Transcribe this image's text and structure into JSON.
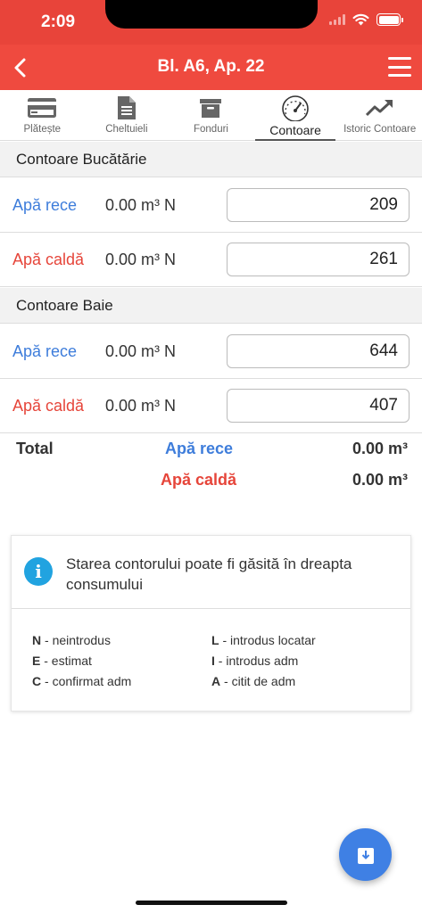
{
  "status_bar": {
    "time": "2:09"
  },
  "header": {
    "title": "Bl. A6, Ap. 22"
  },
  "tabs": [
    {
      "label": "Plătește",
      "icon": "credit-card-icon"
    },
    {
      "label": "Cheltuieli",
      "icon": "document-icon"
    },
    {
      "label": "Fonduri",
      "icon": "archive-box-icon"
    },
    {
      "label": "Contoare",
      "icon": "speedometer-icon",
      "active": true
    },
    {
      "label": "Istoric Contoare",
      "icon": "trending-up-icon"
    }
  ],
  "sections": [
    {
      "title": "Contoare Bucătărie",
      "meters": [
        {
          "name": "Apă rece",
          "consum": "0.00 m³ N",
          "value": "209"
        },
        {
          "name": "Apă caldă",
          "consum": "0.00 m³ N",
          "value": "261"
        }
      ]
    },
    {
      "title": "Contoare Baie",
      "meters": [
        {
          "name": "Apă rece",
          "consum": "0.00 m³ N",
          "value": "644"
        },
        {
          "name": "Apă caldă",
          "consum": "0.00 m³ N",
          "value": "407"
        }
      ]
    }
  ],
  "totals": {
    "label": "Total",
    "cold_label": "Apă rece",
    "cold_value": "0.00 m³",
    "hot_label": "Apă caldă",
    "hot_value": "0.00 m³"
  },
  "info": {
    "icon_letter": "i",
    "text": "Starea contorului poate fi găsită în dreapta consumului",
    "legend": [
      {
        "code": "N",
        "desc": " - neintrodus"
      },
      {
        "code": "E",
        "desc": " - estimat"
      },
      {
        "code": "C",
        "desc": " - confirmat adm"
      },
      {
        "code": "L",
        "desc": " - introdus locatar"
      },
      {
        "code": "I",
        "desc": " - introdus adm"
      },
      {
        "code": "A",
        "desc": " - citit de adm"
      }
    ]
  },
  "colors": {
    "header_red": "#ef4a3f",
    "cold_blue": "#3e7ddb",
    "hot_red": "#e6453a",
    "info_blue": "#21a3e0",
    "fab_blue": "#3f80e4"
  }
}
